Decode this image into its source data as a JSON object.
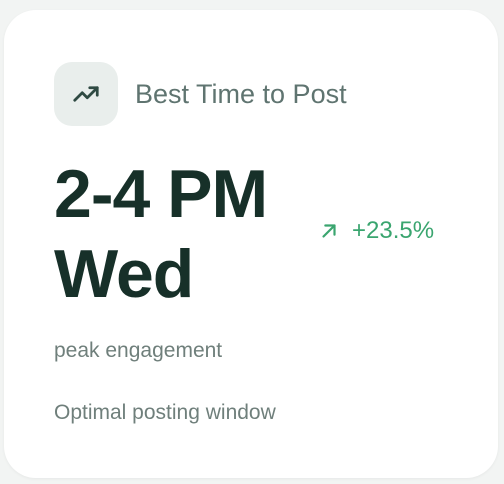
{
  "card": {
    "icon": "trending-up-icon",
    "title": "Best Time to Post",
    "time": "2-4 PM",
    "day": "Wed",
    "trend": {
      "icon": "arrow-up-right-icon",
      "value": "+23.5%"
    },
    "metric_label": "peak engagement",
    "description": "Optimal posting window"
  },
  "colors": {
    "accent_green": "#3aa56f",
    "heading_dark": "#173029",
    "muted_text": "#6f7f7b",
    "icon_bg": "#e9eeec"
  }
}
